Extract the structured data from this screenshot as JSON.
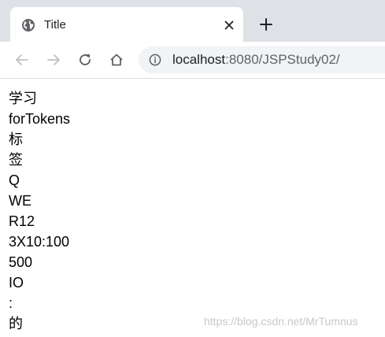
{
  "browser": {
    "tab": {
      "title": "Title",
      "favicon": "globe-icon",
      "close_icon": "close-icon"
    },
    "new_tab_icon": "plus-icon",
    "toolbar": {
      "back_icon": "back-arrow-icon",
      "forward_icon": "forward-arrow-icon",
      "reload_icon": "reload-icon",
      "home_icon": "home-icon"
    },
    "address_bar": {
      "info_icon": "info-icon",
      "url_host": "localhost",
      "url_rest": ":8080/JSPStudy02/"
    }
  },
  "page": {
    "lines": [
      "学习",
      "forTokens",
      "标",
      "签",
      "Q",
      "WE",
      "R12",
      "3X10:100",
      "500",
      "IO",
      ":",
      "的"
    ]
  },
  "watermark": "https://blog.csdn.net/MrTumnus",
  "colors": {
    "tabstrip_bg": "#dee1e6",
    "omnibox_bg": "#f1f3f4",
    "icon_gray": "#5f6368",
    "disabled_icon": "#bdc1c6",
    "text": "#000000"
  }
}
